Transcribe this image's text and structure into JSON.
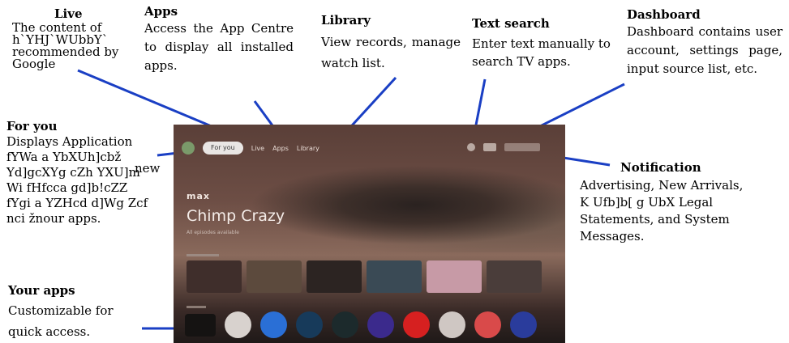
{
  "callouts": {
    "live": {
      "title": "Live",
      "desc": "The content of\nh`YHJ`WUbbY`\nrecommended by\nGoogle"
    },
    "apps": {
      "title": "Apps",
      "desc": "Access the App Centre to display all installed apps."
    },
    "library": {
      "title": "Library",
      "desc": "View records, manage watch list."
    },
    "text_search": {
      "title": "Text search",
      "desc": "Enter text manually to search TV apps."
    },
    "dashboard": {
      "title": "Dashboard",
      "desc": "Dashboard contains user account, settings page, input source list, etc."
    },
    "for_you": {
      "title": "For you",
      "desc": "Displays Application\nfYWa a YbXUh]cbž\nYd]gcXYg cZh YXU]m\nWi fHfcca gd]b!cZZ\nfYgi a YZHcd d]Wg Zcf\nnci žnour apps.",
      "extra": "new"
    },
    "notification": {
      "title": "Notification",
      "desc": "Advertising, New Arrivals,\nK Ufb]b[ g UbX Legal\nStatements, and System\nMessages."
    },
    "your_apps": {
      "title": "Your apps",
      "desc": "Customizable for quick access."
    }
  },
  "tv": {
    "nav": {
      "for_you": "For you",
      "live": "Live",
      "apps": "Apps",
      "library": "Library"
    },
    "brand": "max",
    "show_title": "Chimp Crazy",
    "show_sub": "All episodes available"
  },
  "colors": {
    "leader": "#1a3fc4"
  }
}
